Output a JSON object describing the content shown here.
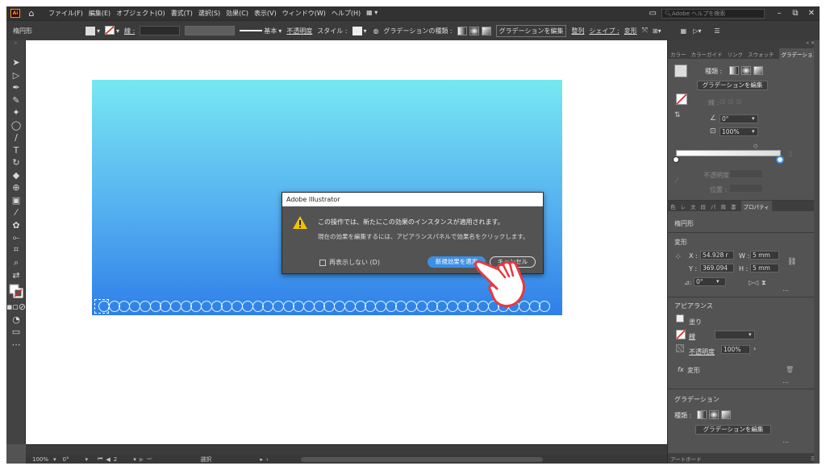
{
  "menubar": {
    "logo": "Ai",
    "items": [
      "ファイル(F)",
      "編集(E)",
      "オブジェクト(O)",
      "書式(T)",
      "選択(S)",
      "効果(C)",
      "表示(V)",
      "ウィンドウ(W)",
      "ヘルプ(H)"
    ],
    "search_placeholder": "Adobe ヘルプを検索"
  },
  "control_bar": {
    "object_type": "楕円形",
    "stroke_label": "線 :",
    "stroke_profile": "基本",
    "opacity_label": "不透明度",
    "style_label": "スタイル :",
    "gradient_type_label": "グラデーションの種類 :",
    "edit_gradient": "グラデーションを編集",
    "align": "整列",
    "shape": "シェイプ :",
    "transform": "変形"
  },
  "dialog": {
    "title": "Adobe Illustrator",
    "message": "この操作では、新たにこの効果のインスタンスが適用されます。",
    "detail": "現在の効果を編集するには、アピアランスパネルで効果名をクリックします。",
    "checkbox_label": "再表示しない (D)",
    "apply_button": "新規効果を適用",
    "cancel_button": "キャンセル"
  },
  "status_bar": {
    "zoom": "100%",
    "rotation": "0°",
    "artboard_number": "2",
    "tool": "選択"
  },
  "gradient_panel": {
    "tabs": [
      "カラー",
      "カラーガイド",
      "リンク",
      "スウォッチ",
      "グラデーション"
    ],
    "type_label": "種類 :",
    "edit_button": "グラデーションを編集",
    "stroke_label": "線 :",
    "angle": "0°",
    "aspect": "100%",
    "opacity_label": "不透明度 :",
    "location_label": "位置 :"
  },
  "properties_panel": {
    "tabs": [
      "色",
      "レ",
      "文",
      "段",
      "パ",
      "周",
      "書",
      "プロパティ"
    ],
    "object_type": "楕円形",
    "transform_title": "変形",
    "x": "54.928 r",
    "y": "369.094",
    "w": "5 mm",
    "h": "5 mm",
    "angle": "0°",
    "appearance_title": "アピアランス",
    "fill_label": "塗り",
    "stroke_label": "線",
    "opacity_label": "不透明度",
    "opacity_value": "100%",
    "effect_name": "変形",
    "gradient_title": "グラデーション",
    "type_label": "種類 :",
    "edit_button": "グラデーションを編集",
    "artboard_tab": "アートボード"
  },
  "colors": {
    "accent": "#3a8fe6",
    "ui_dark": "#323232",
    "panel": "#535353",
    "gradient_top": "#77e8f2",
    "gradient_bottom": "#2f7fe8",
    "hand": "#e8383d"
  }
}
